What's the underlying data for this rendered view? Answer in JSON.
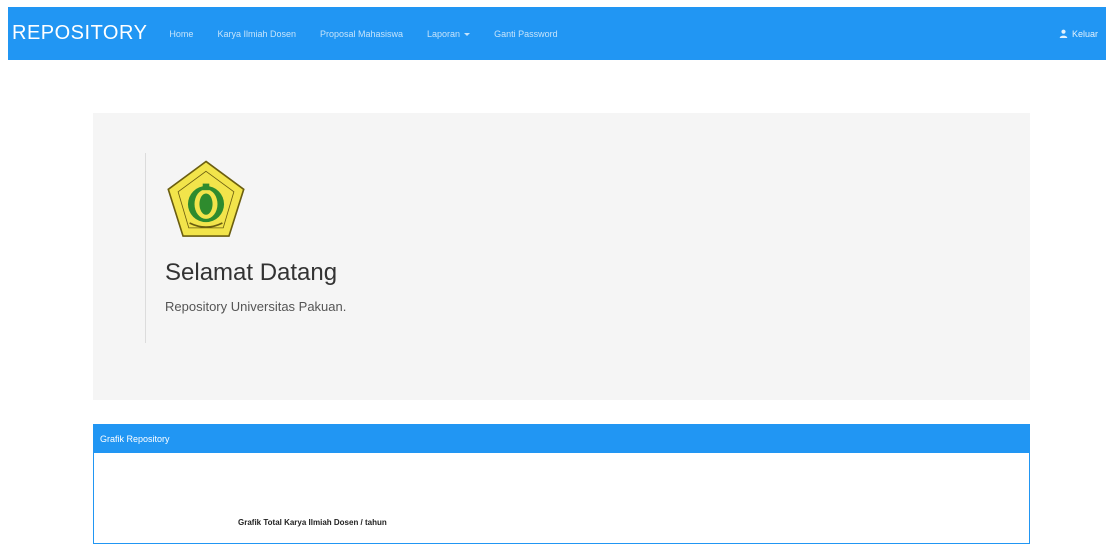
{
  "navbar": {
    "brand": "REPOSITORY",
    "items": [
      {
        "label": "Home"
      },
      {
        "label": "Karya Ilmiah Dosen"
      },
      {
        "label": "Proposal Mahasiswa"
      },
      {
        "label": "Laporan"
      },
      {
        "label": "Ganti Password"
      }
    ],
    "user_label": "Keluar"
  },
  "jumbotron": {
    "title": "Selamat Datang",
    "subtitle": "Repository Universitas Pakuan."
  },
  "panel": {
    "heading": "Grafik Repository",
    "chart_title": "Grafik Total Karya Ilmiah Dosen / tahun"
  },
  "colors": {
    "primary": "#2196f3",
    "jumbotron_bg": "#f5f5f5",
    "logo_yellow": "#f2e44b",
    "logo_green": "#2e8b2e"
  }
}
